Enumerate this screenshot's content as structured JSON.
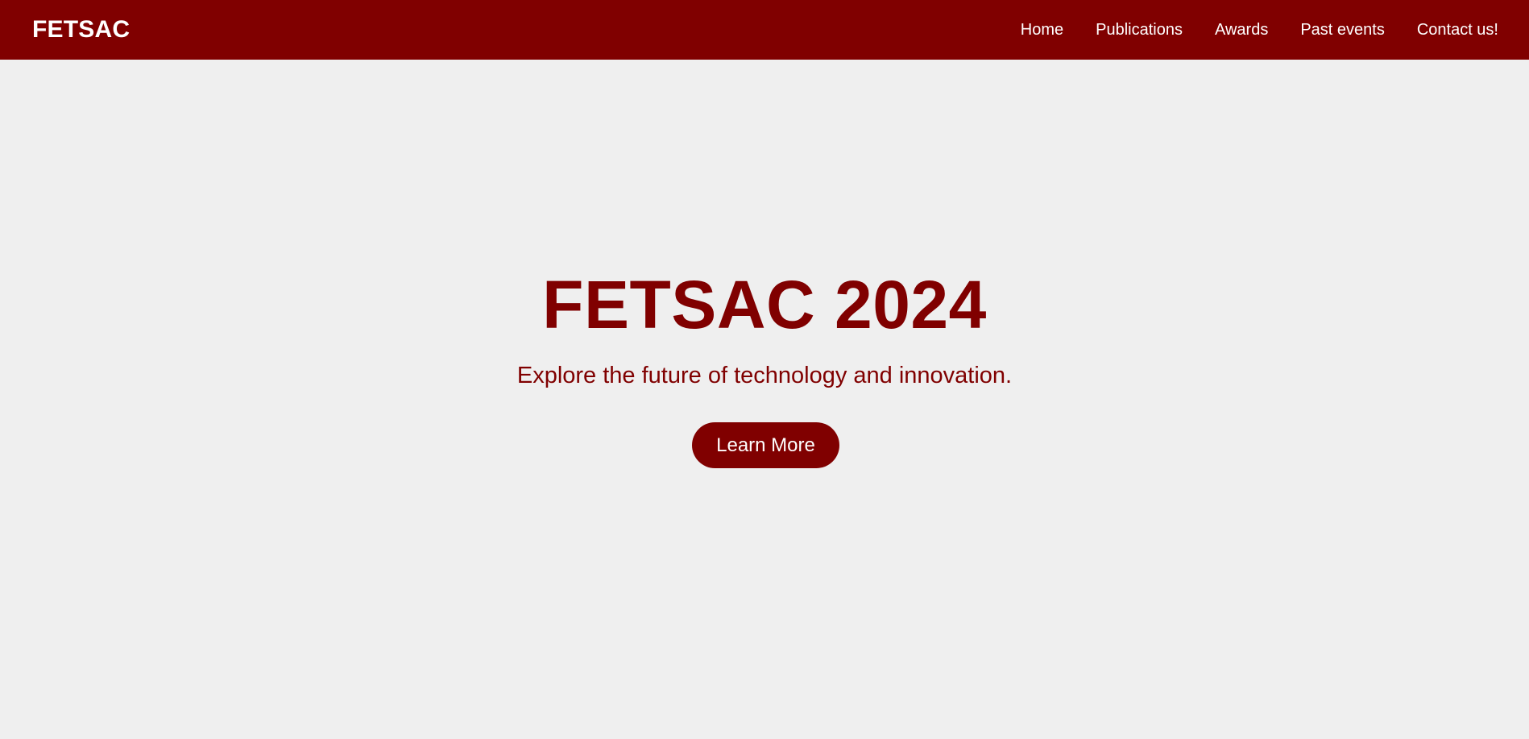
{
  "header": {
    "brand": "FETSAC",
    "nav": [
      {
        "label": "Home"
      },
      {
        "label": "Publications"
      },
      {
        "label": "Awards"
      },
      {
        "label": "Past events"
      },
      {
        "label": "Contact us!"
      }
    ]
  },
  "hero": {
    "title": "FETSAC 2024",
    "subtitle": "Explore the future of technology and innovation.",
    "cta_label": "Learn More"
  },
  "colors": {
    "brand": "#800000",
    "background": "#efefef",
    "text_on_brand": "#ffffff"
  }
}
